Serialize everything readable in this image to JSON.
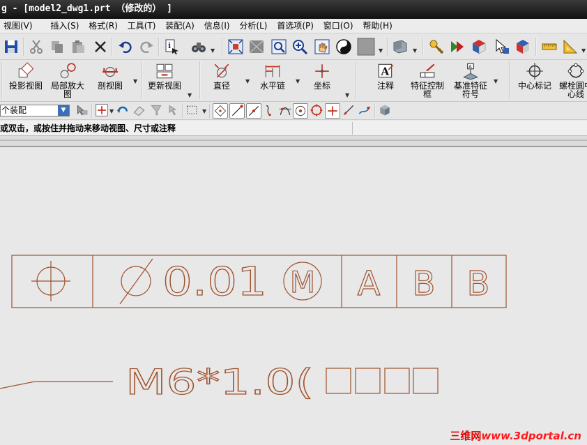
{
  "window": {
    "title": "g - [model2_dwg1.prt （修改的） ]"
  },
  "menubar": {
    "items": [
      "视图(V)",
      "插入(S)",
      "格式(R)",
      "工具(T)",
      "装配(A)",
      "信息(I)",
      "分析(L)",
      "首选项(P)",
      "窗口(O)",
      "帮助(H)"
    ]
  },
  "drafting_toolbar": {
    "buttons": [
      "投影视图",
      "局部放大图",
      "剖视图",
      "更新视图",
      "直径",
      "水平链",
      "坐标",
      "注释",
      "特征控制框",
      "基准特征符号",
      "中心标记",
      "螺栓圆中心线"
    ],
    "labels_split": {
      "detail_view": [
        "局部放大",
        "图"
      ],
      "fcf": [
        "特征控制",
        "框"
      ],
      "datum": [
        "基准特征",
        "符号"
      ],
      "bolt": [
        "螺栓圆中",
        "心线"
      ]
    }
  },
  "selection_bar": {
    "scope_value": "个装配"
  },
  "cue_line": {
    "text": "或双击，或按住并拖动来移动视图、尺寸或注释"
  },
  "drawing": {
    "fcf": {
      "diameter_symbol": "Ø",
      "tolerance": "0.01",
      "modifier": "M",
      "datums": [
        "A",
        "B",
        "B"
      ]
    },
    "thread_note": {
      "text": "M6*1.0("
    }
  },
  "watermark": {
    "brand": "三维网",
    "url": "www.3dportal.cn"
  },
  "colors": {
    "drawing": "#a0522d",
    "watermark": "#e00000",
    "accent": "#3b6fb6"
  }
}
